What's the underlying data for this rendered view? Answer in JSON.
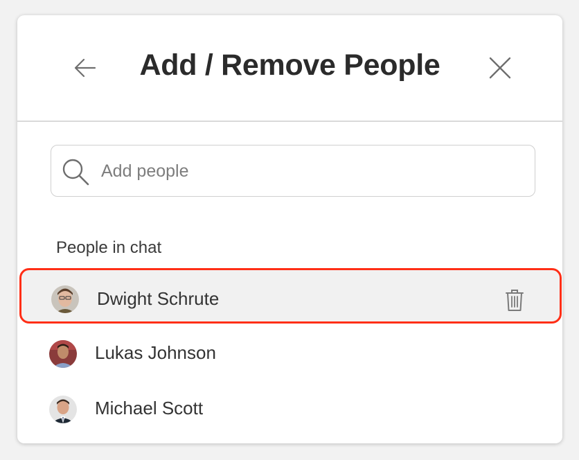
{
  "dialog": {
    "title": "Add / Remove People",
    "back_icon": "arrow-left-icon",
    "close_icon": "close-icon"
  },
  "search": {
    "placeholder": "Add people",
    "value": "",
    "icon": "search-icon"
  },
  "people_section": {
    "label": "People in chat",
    "people": [
      {
        "name": "Dwight Schrute",
        "highlighted": true,
        "action_icon": "trash-icon"
      },
      {
        "name": "Lukas Johnson",
        "highlighted": false
      },
      {
        "name": "Michael Scott",
        "highlighted": false
      }
    ]
  },
  "colors": {
    "highlight_border": "#ff2e16",
    "highlight_bg": "#f1f1f1",
    "text": "#2e2e2e"
  }
}
